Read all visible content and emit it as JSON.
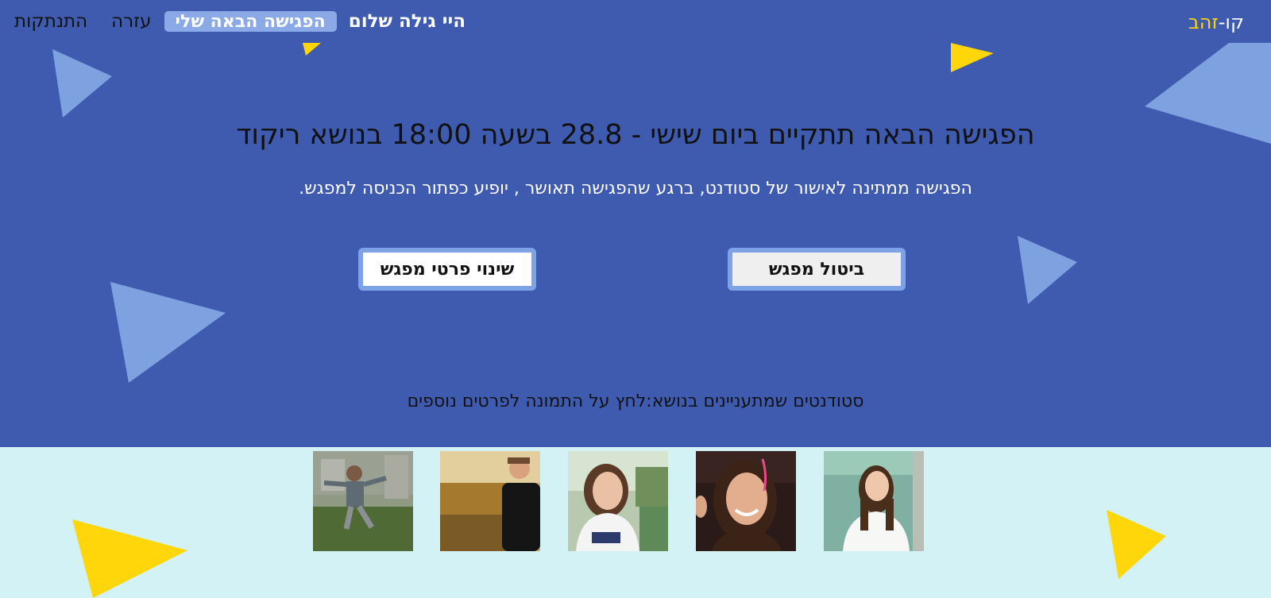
{
  "brand": {
    "part1": "קו-",
    "part2": "זהב"
  },
  "nav": {
    "greeting": "היי גילה שלום",
    "my_next_meeting": "הפגישה הבאה שלי",
    "help": "עזרה",
    "logout": "התנתקות"
  },
  "meeting": {
    "headline": "הפגישה הבאה תתקיים ביום שישי - 28.8 בשעה 18:00 בנושא ריקוד",
    "status_note": "הפגישה ממתינה לאישור של סטודנט, ברגע שהפגישה תאושר , יופיע כפתור הכניסה למפגש."
  },
  "buttons": {
    "cancel_meeting": "ביטול מפגש",
    "change_details": "שינוי פרטי מפגש"
  },
  "students": {
    "caption": "סטודנטים שמתעניינים בנושא:לחץ על התמונה לפרטים נוספים",
    "photos": [
      {
        "name": "student-photo-1"
      },
      {
        "name": "student-photo-2"
      },
      {
        "name": "student-photo-3"
      },
      {
        "name": "student-photo-4"
      },
      {
        "name": "student-photo-5"
      }
    ]
  },
  "colors": {
    "hero_bg": "#3e5bb0",
    "lower_bg": "#d3f2f6",
    "accent_yellow": "#ffd60a",
    "triangle_light": "#7ea2e0",
    "button_border": "#7ea2e6"
  }
}
